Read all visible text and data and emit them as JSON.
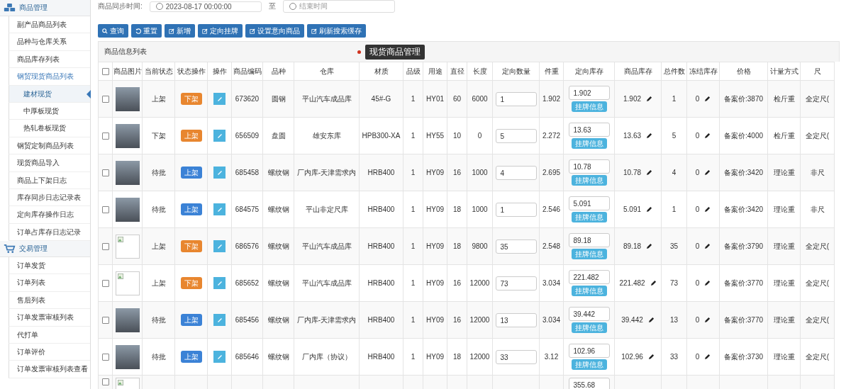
{
  "sidebar": {
    "groups": [
      {
        "title": "商品管理",
        "items": [
          {
            "label": "副产品商品列表",
            "selected": false
          },
          {
            "label": "品种与仓库关系",
            "selected": false
          },
          {
            "label": "商品库存列表",
            "selected": false
          },
          {
            "label": "钢贸现货商品列表",
            "selected": false,
            "expanded": true,
            "children": [
              {
                "label": "建材现货",
                "selected": true
              },
              {
                "label": "中厚板现货",
                "selected": false
              },
              {
                "label": "热轧卷板现货",
                "selected": false
              }
            ]
          },
          {
            "label": "钢贸定制商品列表",
            "selected": false
          },
          {
            "label": "现货商品导入",
            "selected": false
          },
          {
            "label": "商品上下架日志",
            "selected": false
          },
          {
            "label": "库存同步日志记录表",
            "selected": false
          },
          {
            "label": "定向库存操作日志",
            "selected": false
          },
          {
            "label": "订单占库存日志记录",
            "selected": false
          }
        ]
      },
      {
        "title": "交易管理",
        "items": [
          {
            "label": "订单发货",
            "selected": false
          },
          {
            "label": "订单列表",
            "selected": false
          },
          {
            "label": "售后列表",
            "selected": false
          },
          {
            "label": "订单发票审核列表",
            "selected": false
          },
          {
            "label": "代打单",
            "selected": false
          },
          {
            "label": "订单评价",
            "selected": false
          },
          {
            "label": "订单发票审核列表查看",
            "selected": false
          }
        ]
      }
    ]
  },
  "filter": {
    "label": "商品同步时间:",
    "start": "2023-08-17 00:00:00",
    "separator": "至",
    "end_placeholder": "结束时间"
  },
  "toolbar": [
    {
      "kind": "search",
      "label": "查询"
    },
    {
      "kind": "reset",
      "label": "重置"
    },
    {
      "kind": "edit",
      "label": "新增"
    },
    {
      "kind": "edit",
      "label": "定向挂牌"
    },
    {
      "kind": "edit",
      "label": "设置意向商品"
    },
    {
      "kind": "edit",
      "label": "刷新搜索缓存"
    }
  ],
  "panel_title": "商品信息列表",
  "tooltip": "现货商品管理",
  "table": {
    "all_checked": false,
    "columns": [
      "商品图片",
      "当前状态",
      "状态操作",
      "操作",
      "商品编码",
      "品种",
      "仓库",
      "材质",
      "品级",
      "用途",
      "直径",
      "长度",
      "定向数量",
      "件重",
      "定向库存",
      "商品库存",
      "总件数",
      "冻结库存",
      "价格",
      "计量方式",
      "尺"
    ],
    "rows": [
      {
        "kind": "photo",
        "checked": false,
        "status": "上架",
        "action": {
          "label": "下架",
          "color": "#e8862f"
        },
        "code": "673620",
        "variety": "圆钢",
        "warehouse": "平山汽车成品库",
        "material": "45#-G",
        "grade": "1",
        "use": "HY01",
        "diameter": "60",
        "length": "6000",
        "quantity": "1",
        "piece_weight": "1.902",
        "directed_stock": "1.902",
        "list_button": "挂牌信息",
        "stock": "1.902",
        "total": "1",
        "frozen": "0",
        "price": "备案价:3870",
        "metering": "检斤重",
        "size": "全定尺("
      },
      {
        "kind": "photo",
        "checked": false,
        "status": "下架",
        "action": {
          "label": "上架",
          "color": "#e8862f"
        },
        "code": "656509",
        "variety": "盘圆",
        "warehouse": "雄安东库",
        "material": "HPB300-XA",
        "grade": "1",
        "use": "HY55",
        "diameter": "10",
        "length": "0",
        "quantity": "5",
        "piece_weight": "2.272",
        "directed_stock": "13.63",
        "list_button": "挂牌信息",
        "stock": "13.63",
        "total": "5",
        "frozen": "0",
        "price": "备案价:4000",
        "metering": "检斤重",
        "size": "全定尺("
      },
      {
        "kind": "photo",
        "checked": false,
        "status": "待批",
        "action": {
          "label": "上架",
          "color": "#3b82d6"
        },
        "code": "685458",
        "variety": "螺纹钢",
        "warehouse": "厂内库-天津需求内",
        "material": "HRB400",
        "grade": "1",
        "use": "HY09",
        "diameter": "16",
        "length": "1000",
        "quantity": "4",
        "piece_weight": "2.695",
        "directed_stock": "10.78",
        "list_button": "挂牌信息",
        "stock": "10.78",
        "total": "4",
        "frozen": "0",
        "price": "备案价:3420",
        "metering": "理论重",
        "size": "非尺"
      },
      {
        "kind": "photo",
        "checked": false,
        "status": "待批",
        "action": {
          "label": "上架",
          "color": "#3b82d6"
        },
        "code": "684575",
        "variety": "螺纹钢",
        "warehouse": "平山非定尺库",
        "material": "HRB400",
        "grade": "1",
        "use": "HY09",
        "diameter": "18",
        "length": "1000",
        "quantity": "1",
        "piece_weight": "2.546",
        "directed_stock": "5.091",
        "list_button": "挂牌信息",
        "stock": "5.091",
        "total": "1",
        "frozen": "0",
        "price": "备案价:3420",
        "metering": "理论重",
        "size": "非尺"
      },
      {
        "kind": "broken",
        "checked": false,
        "status": "上架",
        "action": {
          "label": "下架",
          "color": "#e8862f"
        },
        "code": "686576",
        "variety": "螺纹钢",
        "warehouse": "平山汽车成品库",
        "material": "HRB400",
        "grade": "1",
        "use": "HY09",
        "diameter": "18",
        "length": "9800",
        "quantity": "35",
        "piece_weight": "2.548",
        "directed_stock": "89.18",
        "list_button": "挂牌信息",
        "stock": "89.18",
        "total": "35",
        "frozen": "0",
        "price": "备案价:3790",
        "metering": "理论重",
        "size": "全定尺("
      },
      {
        "kind": "broken",
        "checked": false,
        "status": "上架",
        "action": {
          "label": "下架",
          "color": "#e8862f"
        },
        "code": "685652",
        "variety": "螺纹钢",
        "warehouse": "平山汽车成品库",
        "material": "HRB400",
        "grade": "1",
        "use": "HY09",
        "diameter": "16",
        "length": "12000",
        "quantity": "73",
        "piece_weight": "3.034",
        "directed_stock": "221.482",
        "list_button": "挂牌信息",
        "stock": "221.482",
        "total": "73",
        "frozen": "0",
        "price": "备案价:3770",
        "metering": "理论重",
        "size": "全定尺("
      },
      {
        "kind": "photo",
        "checked": false,
        "status": "待批",
        "action": {
          "label": "上架",
          "color": "#3b82d6"
        },
        "code": "685456",
        "variety": "螺纹钢",
        "warehouse": "厂内库-天津需求内",
        "material": "HRB400",
        "grade": "1",
        "use": "HY09",
        "diameter": "16",
        "length": "12000",
        "quantity": "13",
        "piece_weight": "3.034",
        "directed_stock": "39.442",
        "list_button": "挂牌信息",
        "stock": "39.442",
        "total": "13",
        "frozen": "0",
        "price": "备案价:3770",
        "metering": "理论重",
        "size": "全定尺("
      },
      {
        "kind": "photo",
        "checked": false,
        "status": "待批",
        "action": {
          "label": "上架",
          "color": "#3b82d6"
        },
        "code": "685646",
        "variety": "螺纹钢",
        "warehouse": "厂内库（协议）",
        "material": "HRB400",
        "grade": "1",
        "use": "HY09",
        "diameter": "18",
        "length": "12000",
        "quantity": "33",
        "piece_weight": "3.12",
        "directed_stock": "102.96",
        "list_button": "挂牌信息",
        "stock": "102.96",
        "total": "33",
        "frozen": "0",
        "price": "备案价:3730",
        "metering": "理论重",
        "size": "全定尺("
      },
      {
        "kind": "broken",
        "checked": false,
        "directed_stock": "355.68"
      }
    ]
  }
}
